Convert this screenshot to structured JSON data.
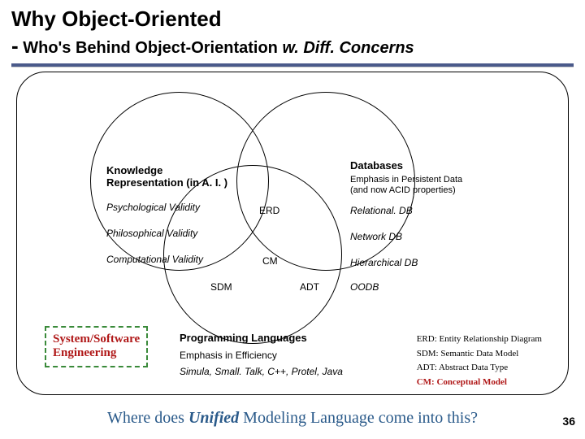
{
  "title": {
    "line1": "Why Object-Oriented",
    "dash": "-",
    "line2_a": "Who's Behind Object-Orientation ",
    "line2_b_italic": "w. Diff. Concerns"
  },
  "kr": {
    "header": "Knowledge Representation (in A. I. )",
    "items": [
      "Psychological Validity",
      "Philosophical Validity",
      "Computational Validity"
    ]
  },
  "db": {
    "header": "Databases",
    "sub": "Emphasis in Persistent Data (and now ACID properties)",
    "items": [
      "Relational. DB",
      "Network DB",
      "Hierarchical DB",
      "OODB"
    ]
  },
  "center": {
    "erd": "ERD",
    "cm": "CM",
    "sdm": "SDM",
    "adt": "ADT"
  },
  "pl": {
    "header": "Programming Languages",
    "sub": "Emphasis in Efficiency",
    "langs": "Simula, Small. Talk, C++, Protel, Java"
  },
  "syseng": {
    "l1": "System/Software",
    "l2": "Engineering"
  },
  "legend": {
    "erd": "ERD: Entity Relationship Diagram",
    "sdm": "SDM: Semantic Data Model",
    "adt": "ADT: Abstract Data Type",
    "cm": "CM: Conceptual Model"
  },
  "footer": {
    "pre": "Where does ",
    "unified": "Unified",
    "post": " Modeling Language come into this?"
  },
  "page": "36"
}
